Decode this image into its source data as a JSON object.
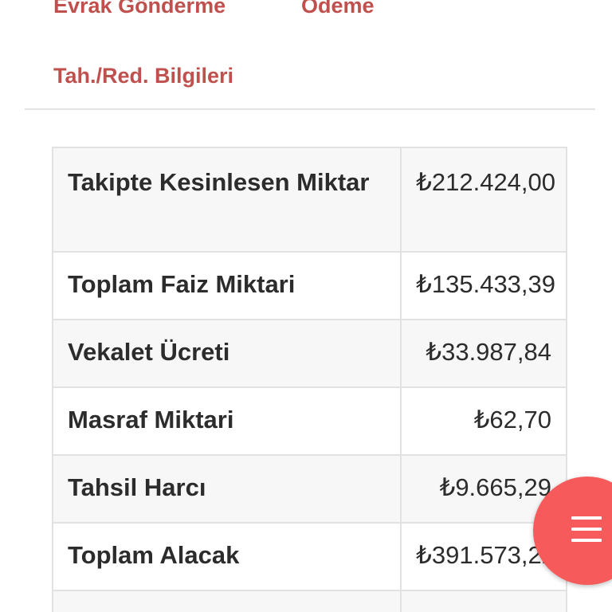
{
  "tabs": {
    "evrak_gonderme": "Evrak Gönderme",
    "odeme": "Ödeme",
    "tah_red": "Tah./Red. Bilgileri"
  },
  "summary": {
    "rows": [
      {
        "label": "Takipte Kesinlesen Miktar",
        "value": "₺212.424,00"
      },
      {
        "label": "Toplam Faiz Miktari",
        "value": "₺135.433,39"
      },
      {
        "label": "Vekalet Ücreti",
        "value": "₺33.987,84"
      },
      {
        "label": "Masraf Miktari",
        "value": "₺62,70"
      },
      {
        "label": "Tahsil Harcı",
        "value": "₺9.665,29"
      },
      {
        "label": "Toplam Alacak",
        "value": "₺391.573,22"
      }
    ]
  },
  "fab": {
    "icon": "menu-icon",
    "color": "#f75a5a"
  },
  "colors": {
    "accent": "#c0504d",
    "text": "#2c2c2c",
    "border": "#e2e2e2"
  }
}
